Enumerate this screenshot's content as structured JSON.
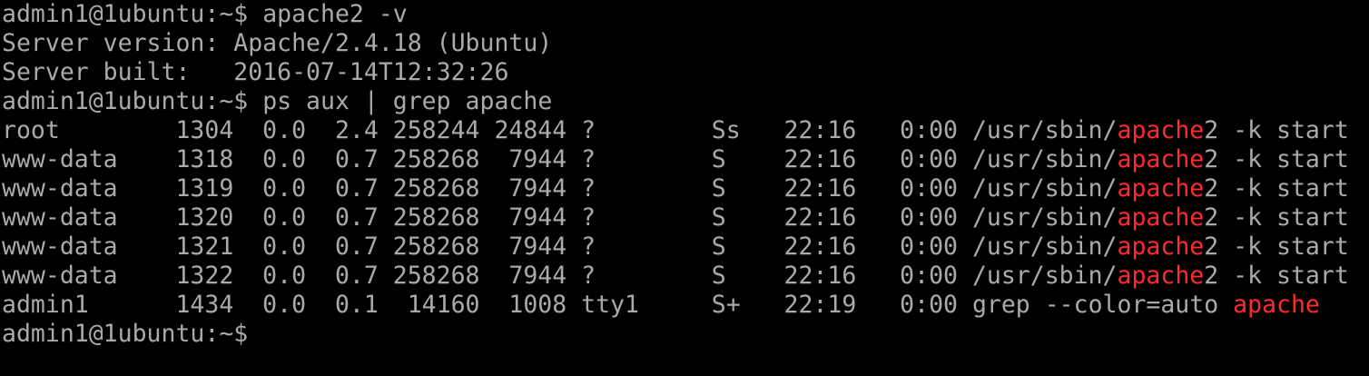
{
  "colors": {
    "background": "#000000",
    "text": "#aaaaaa",
    "match_highlight": "#ff2a2a"
  },
  "terminal": {
    "lines": [
      {
        "prompt": "admin1@1ubuntu:~$ ",
        "command": "apache2 -v"
      },
      {
        "text": "Server version: Apache/2.4.18 (Ubuntu)"
      },
      {
        "text": "Server built:   2016-07-14T12:32:26"
      },
      {
        "prompt": "admin1@1ubuntu:~$ ",
        "command": "ps aux | grep apache"
      }
    ],
    "ps_rows": [
      {
        "prefix": "root        1304  0.0  2.4 258244 24844 ?        Ss   22:16   0:00 /usr/sbin/",
        "match": "apache",
        "suffix": "2 -k start"
      },
      {
        "prefix": "www-data    1318  0.0  0.7 258268  7944 ?        S    22:16   0:00 /usr/sbin/",
        "match": "apache",
        "suffix": "2 -k start"
      },
      {
        "prefix": "www-data    1319  0.0  0.7 258268  7944 ?        S    22:16   0:00 /usr/sbin/",
        "match": "apache",
        "suffix": "2 -k start"
      },
      {
        "prefix": "www-data    1320  0.0  0.7 258268  7944 ?        S    22:16   0:00 /usr/sbin/",
        "match": "apache",
        "suffix": "2 -k start"
      },
      {
        "prefix": "www-data    1321  0.0  0.7 258268  7944 ?        S    22:16   0:00 /usr/sbin/",
        "match": "apache",
        "suffix": "2 -k start"
      },
      {
        "prefix": "www-data    1322  0.0  0.7 258268  7944 ?        S    22:16   0:00 /usr/sbin/",
        "match": "apache",
        "suffix": "2 -k start"
      },
      {
        "prefix": "admin1      1434  0.0  0.1  14160  1008 tty1     S+   22:19   0:00 grep --color=auto ",
        "match": "apache",
        "suffix": ""
      }
    ],
    "final_prompt": "admin1@1ubuntu:~$"
  }
}
